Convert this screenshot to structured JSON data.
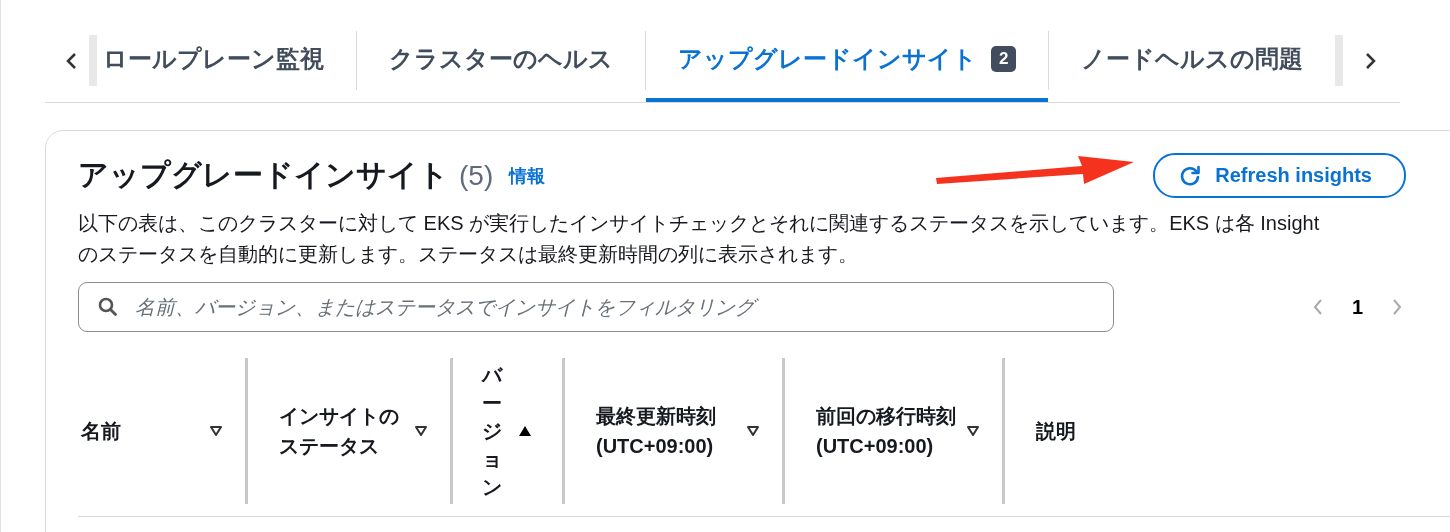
{
  "tabs": [
    {
      "label": "ロールプレーン監視",
      "selected": false
    },
    {
      "label": "クラスターのヘルス",
      "selected": false
    },
    {
      "label": "アップグレードインサイト",
      "selected": true,
      "badge": "2"
    },
    {
      "label": "ノードヘルスの問題",
      "selected": false
    }
  ],
  "panel": {
    "title": "アップグレードインサイト",
    "count": "(5)",
    "info_link": "情報",
    "refresh_button": "Refresh insights",
    "description": "以下の表は、このクラスターに対して EKS が実行したインサイトチェックとそれに関連するステータスを示しています。EKS は各 Insight のステータスを自動的に更新します。ステータスは最終更新時間の列に表示されます。",
    "search": {
      "placeholder": "名前、バージョン、またはステータスでインサイトをフィルタリング"
    },
    "pagination": {
      "page": "1"
    }
  },
  "table": {
    "columns": [
      {
        "label": "名前",
        "kind": "sortable",
        "sorted": false
      },
      {
        "label": "インサイトのステータス",
        "kind": "sortable",
        "sorted": false
      },
      {
        "label": "バージョン",
        "kind": "vertical",
        "sorted": true
      },
      {
        "label": "最終更新時刻 (UTC+09:00)",
        "kind": "sortable",
        "sorted": false
      },
      {
        "label": "前回の移行時刻 (UTC+09:00)",
        "kind": "sortable",
        "sorted": false
      },
      {
        "label": "説明",
        "kind": "plain",
        "sorted": false
      }
    ]
  }
}
